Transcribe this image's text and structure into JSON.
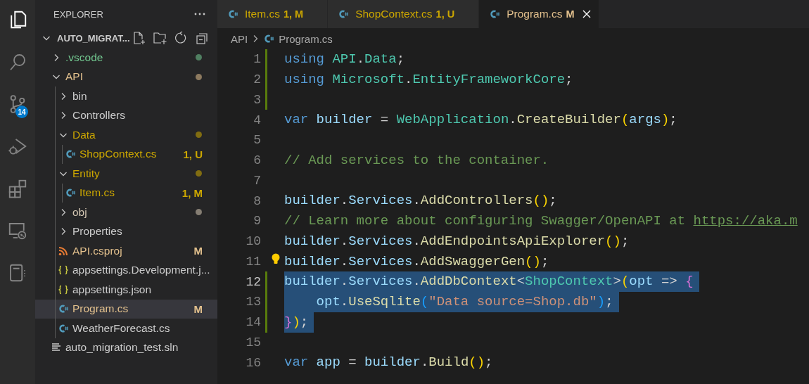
{
  "activity_bar": {
    "items": [
      {
        "kind": "explorer",
        "selected": true
      },
      {
        "kind": "search",
        "selected": false
      },
      {
        "kind": "source-control",
        "selected": false,
        "badge": "14"
      },
      {
        "kind": "run-debug",
        "selected": false
      },
      {
        "kind": "extensions",
        "selected": false
      },
      {
        "kind": "remote",
        "selected": false
      },
      {
        "kind": "notebook",
        "selected": false
      }
    ]
  },
  "sidebar": {
    "title": "EXPLORER",
    "root": {
      "label": "AUTO_MIGRAT...",
      "expanded": true
    },
    "tree": [
      {
        "label": ".vscode",
        "kind": "folder",
        "expanded": false,
        "color": "#73c991",
        "dot": true,
        "selected": false
      },
      {
        "label": "API",
        "kind": "folder",
        "expanded": true,
        "color": "#e2c08d",
        "dot": true,
        "selected": false,
        "children": [
          {
            "label": "bin",
            "kind": "folder",
            "expanded": false,
            "color": "#cccccc",
            "dot": false,
            "selected": false
          },
          {
            "label": "Controllers",
            "kind": "folder",
            "expanded": false,
            "color": "#cccccc",
            "dot": false,
            "selected": false
          },
          {
            "label": "Data",
            "kind": "folder",
            "expanded": true,
            "color": "#cca700",
            "dot": true,
            "selected": false,
            "children": [
              {
                "label": "ShopContext.cs",
                "kind": "csharp",
                "color": "#cca700",
                "badge": "1, U",
                "selected": false
              }
            ]
          },
          {
            "label": "Entity",
            "kind": "folder",
            "expanded": true,
            "color": "#cca700",
            "dot": true,
            "selected": false,
            "children": [
              {
                "label": "Item.cs",
                "kind": "csharp",
                "color": "#cca700",
                "badge": "1, M",
                "selected": false
              }
            ]
          },
          {
            "label": "obj",
            "kind": "folder",
            "expanded": false,
            "color": "#d3c6b2",
            "dot": true,
            "selected": false
          },
          {
            "label": "Properties",
            "kind": "folder",
            "expanded": false,
            "color": "#cccccc",
            "dot": false,
            "selected": false
          },
          {
            "label": "API.csproj",
            "kind": "msbuild",
            "color": "#e2c08d",
            "badge": "M",
            "selected": false
          },
          {
            "label": "appsettings.Development.j...",
            "kind": "json",
            "color": "#cccccc",
            "selected": false
          },
          {
            "label": "appsettings.json",
            "kind": "json",
            "color": "#cccccc",
            "selected": false
          },
          {
            "label": "Program.cs",
            "kind": "csharp",
            "color": "#e2c08d",
            "badge": "M",
            "selected": true
          },
          {
            "label": "WeatherForecast.cs",
            "kind": "csharp",
            "color": "#cccccc",
            "selected": false
          }
        ]
      },
      {
        "label": "auto_migration_test.sln",
        "kind": "solution",
        "color": "#cccccc",
        "selected": false
      }
    ]
  },
  "editor": {
    "tabs": [
      {
        "label": "Item.cs",
        "kind": "csharp",
        "badge": "1, M",
        "color": "#cca700",
        "selected": false
      },
      {
        "label": "ShopContext.cs",
        "kind": "csharp",
        "badge": "1, U",
        "color": "#cca700",
        "selected": false
      },
      {
        "label": "Program.cs",
        "kind": "csharp",
        "badge": "M",
        "color": "#e2c08d",
        "selected": true
      }
    ],
    "breadcrumb": [
      {
        "label": "API",
        "kind": "folder"
      },
      {
        "label": "Program.cs",
        "kind": "csharp"
      }
    ],
    "lines": [
      {
        "number": "1",
        "changed": true,
        "tokens": [
          {
            "kind": "keyword",
            "text": "using "
          },
          {
            "kind": "type",
            "text": "API"
          },
          {
            "kind": "plain",
            "text": "."
          },
          {
            "kind": "type",
            "text": "Data"
          },
          {
            "kind": "plain",
            "text": ";"
          }
        ]
      },
      {
        "number": "2",
        "changed": true,
        "tokens": [
          {
            "kind": "keyword",
            "text": "using "
          },
          {
            "kind": "type",
            "text": "Microsoft"
          },
          {
            "kind": "plain",
            "text": "."
          },
          {
            "kind": "type",
            "text": "EntityFrameworkCore"
          },
          {
            "kind": "plain",
            "text": ";"
          }
        ]
      },
      {
        "number": "3",
        "changed": true
      },
      {
        "number": "4",
        "tokens": [
          {
            "kind": "keyword",
            "text": "var "
          },
          {
            "kind": "variable",
            "text": "builder"
          },
          {
            "kind": "plain",
            "text": " = "
          },
          {
            "kind": "type",
            "text": "WebApplication"
          },
          {
            "kind": "plain",
            "text": "."
          },
          {
            "kind": "method",
            "text": "CreateBuilder"
          },
          {
            "kind": "bracket1",
            "text": "("
          },
          {
            "kind": "variable",
            "text": "args"
          },
          {
            "kind": "bracket1",
            "text": ")"
          },
          {
            "kind": "plain",
            "text": ";"
          }
        ]
      },
      {
        "number": "5"
      },
      {
        "number": "6",
        "tokens": [
          {
            "kind": "comment",
            "text": "// Add services to the container."
          }
        ]
      },
      {
        "number": "7"
      },
      {
        "number": "8",
        "tokens": [
          {
            "kind": "variable",
            "text": "builder"
          },
          {
            "kind": "plain",
            "text": "."
          },
          {
            "kind": "variable",
            "text": "Services"
          },
          {
            "kind": "plain",
            "text": "."
          },
          {
            "kind": "method",
            "text": "AddControllers"
          },
          {
            "kind": "bracket1",
            "text": "()"
          },
          {
            "kind": "plain",
            "text": ";"
          }
        ]
      },
      {
        "number": "9",
        "tokens": [
          {
            "kind": "comment",
            "text": "// Learn more about configuring Swagger/OpenAPI at "
          },
          {
            "kind": "link",
            "text": "https://aka.m"
          }
        ]
      },
      {
        "number": "10",
        "tokens": [
          {
            "kind": "variable",
            "text": "builder"
          },
          {
            "kind": "plain",
            "text": "."
          },
          {
            "kind": "variable",
            "text": "Services"
          },
          {
            "kind": "plain",
            "text": "."
          },
          {
            "kind": "method",
            "text": "AddEndpointsApiExplorer"
          },
          {
            "kind": "bracket1",
            "text": "()"
          },
          {
            "kind": "plain",
            "text": ";"
          }
        ]
      },
      {
        "number": "11",
        "lightbulb": true,
        "tokens": [
          {
            "kind": "variable",
            "text": "builder"
          },
          {
            "kind": "plain",
            "text": "."
          },
          {
            "kind": "variable",
            "text": "Services"
          },
          {
            "kind": "plain",
            "text": "."
          },
          {
            "kind": "method",
            "text": "AddSwaggerGen"
          },
          {
            "kind": "bracket1",
            "text": "()"
          },
          {
            "kind": "plain",
            "text": ";"
          }
        ]
      },
      {
        "number": "12",
        "changed": true,
        "selected": true,
        "current": true,
        "tokens": [
          {
            "kind": "variable",
            "text": "builder"
          },
          {
            "kind": "plain",
            "text": "."
          },
          {
            "kind": "variable",
            "text": "Services"
          },
          {
            "kind": "plain",
            "text": "."
          },
          {
            "kind": "method",
            "text": "AddDbContext"
          },
          {
            "kind": "plain",
            "text": "<"
          },
          {
            "kind": "type",
            "text": "ShopContext"
          },
          {
            "kind": "plain",
            "text": ">"
          },
          {
            "kind": "bracket1",
            "text": "("
          },
          {
            "kind": "variable",
            "text": "opt"
          },
          {
            "kind": "plain",
            "text": " => "
          },
          {
            "kind": "bracket2",
            "text": "{"
          }
        ]
      },
      {
        "number": "13",
        "changed": true,
        "selected": true,
        "tokens": [
          {
            "kind": "variable",
            "text": "    opt"
          },
          {
            "kind": "plain",
            "text": "."
          },
          {
            "kind": "method",
            "text": "UseSqlite"
          },
          {
            "kind": "bracket3",
            "text": "("
          },
          {
            "kind": "string",
            "text": "\"Data source=Shop.db\""
          },
          {
            "kind": "bracket3",
            "text": ")"
          },
          {
            "kind": "plain",
            "text": ";"
          }
        ]
      },
      {
        "number": "14",
        "changed": true,
        "selected": true,
        "tokens": [
          {
            "kind": "bracket2",
            "text": "}"
          },
          {
            "kind": "bracket1",
            "text": ")"
          },
          {
            "kind": "plain",
            "text": ";"
          }
        ]
      },
      {
        "number": "15"
      },
      {
        "number": "16",
        "tokens": [
          {
            "kind": "keyword",
            "text": "var "
          },
          {
            "kind": "variable",
            "text": "app"
          },
          {
            "kind": "plain",
            "text": " = "
          },
          {
            "kind": "variable",
            "text": "builder"
          },
          {
            "kind": "plain",
            "text": "."
          },
          {
            "kind": "method",
            "text": "Build"
          },
          {
            "kind": "bracket1",
            "text": "()"
          },
          {
            "kind": "plain",
            "text": ";"
          }
        ]
      }
    ]
  }
}
